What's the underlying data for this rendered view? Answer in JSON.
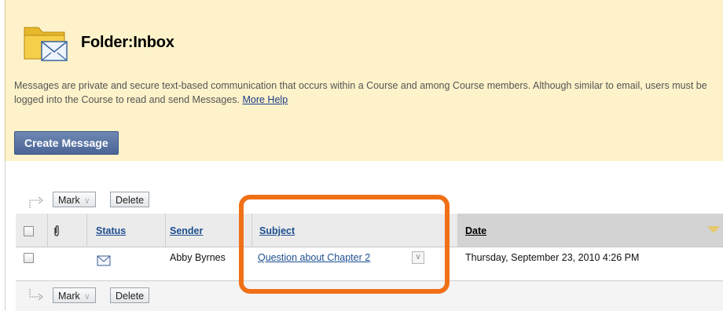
{
  "header": {
    "title": "Folder:Inbox",
    "description": "Messages are private and secure text-based communication that occurs within a Course and among Course members. Although similar to email, users must be logged into the Course to read and send Messages.",
    "more_help": "More Help",
    "create_button": "Create Message"
  },
  "toolbar": {
    "mark_label": "Mark",
    "delete_label": "Delete"
  },
  "table": {
    "columns": {
      "status": "Status",
      "sender": "Sender",
      "subject": "Subject",
      "date": "Date"
    },
    "rows": [
      {
        "sender": "Abby Byrnes",
        "subject": "Question about Chapter 2",
        "date": "Thursday, September 23, 2010 4:26 PM"
      }
    ]
  },
  "colors": {
    "panel_bg": "#fdf2c9",
    "highlight": "#f07018",
    "link": "#1d4e8f"
  }
}
